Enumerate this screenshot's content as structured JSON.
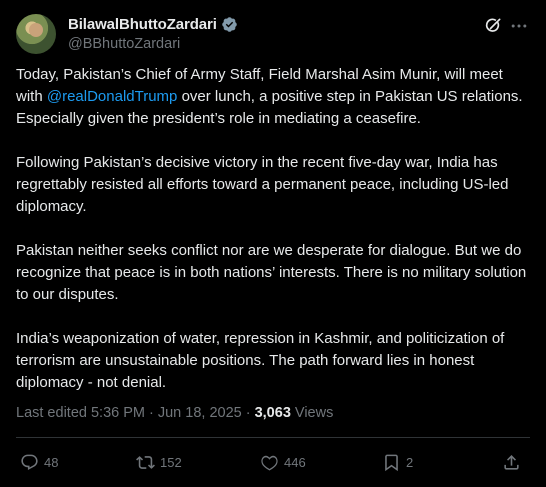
{
  "author": {
    "display_name": "BilawalBhuttoZardari",
    "handle": "@BBhuttoZardari"
  },
  "tweet": {
    "p1_before": "Today, Pakistan’s Chief of Army Staff, Field Marshal Asim Munir, will meet with ",
    "p1_mention": "@realDonaldTrump",
    "p1_after": " over lunch, a positive step in Pakistan US relations. Especially given the president’s role in mediating a ceasefire.",
    "p2": "Following Pakistan’s decisive victory in the recent five-day war, India has regrettably resisted all efforts toward a permanent peace,  including US-led diplomacy.",
    "p3": "Pakistan neither seeks conflict nor are we desperate for dialogue. But we do recognize that peace is in both nations’ interests. There is no military solution to our disputes.",
    "p4": "India’s weaponization of water, repression in Kashmir, and politicization of terrorism are unsustainable positions. The path forward lies in honest diplomacy - not denial."
  },
  "meta": {
    "edited": "Last edited 5:36 PM · Jun 18, 2025 · ",
    "views_count": "3,063",
    "views_label": " Views"
  },
  "actions": {
    "replies": "48",
    "reposts": "152",
    "likes": "446",
    "bookmarks": "2"
  },
  "colors": {
    "background": "#000000",
    "text": "#e7e9ea",
    "secondary": "#71767b",
    "link": "#1d9bf0",
    "divider": "#2f3336"
  },
  "icons": [
    "verified-badge-icon",
    "grok-icon",
    "more-icon",
    "reply-icon",
    "repost-icon",
    "like-icon",
    "bookmark-icon",
    "share-icon"
  ]
}
